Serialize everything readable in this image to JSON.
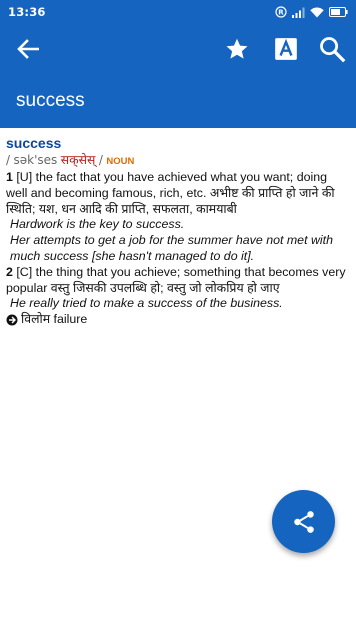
{
  "status_bar": {
    "time": "13:36"
  },
  "app_bar": {
    "title": "success",
    "icons": [
      "arrow-back-icon",
      "star-icon",
      "font-a-icon",
      "search-icon"
    ]
  },
  "entry": {
    "headword": "success",
    "pron_open": "/",
    "pron": "sək'ses",
    "pron_hindi": "सक्‌सेस्‌",
    "pron_close": "/",
    "pos": "NOUN",
    "senses": [
      {
        "num": "1",
        "text": "[U] the fact that you have achieved what you want; doing well and becoming famous, rich, etc. अभीष्ट की प्राप्ति हो जाने की स्थिति; यश, धन आदि की प्राप्ति, सफलता, कामयाबी",
        "examples": [
          "Hardwork is the key to success.",
          "Her attempts to get a job for the summer have not met with much success [she hasn't managed to do it]."
        ]
      },
      {
        "num": "2",
        "text": "[C] the thing that you achieve; something that becomes very popular वस्तु जिसकी उपलब्धि हो; वस्तु जो लोकप्रिय हो जाए",
        "examples": [
          "He really tried to make a success of the business."
        ]
      }
    ],
    "antonym": "विलोम failure"
  },
  "colors": {
    "primary": "#1565c0",
    "headword": "#0d47a1",
    "pos": "#e06c00"
  }
}
